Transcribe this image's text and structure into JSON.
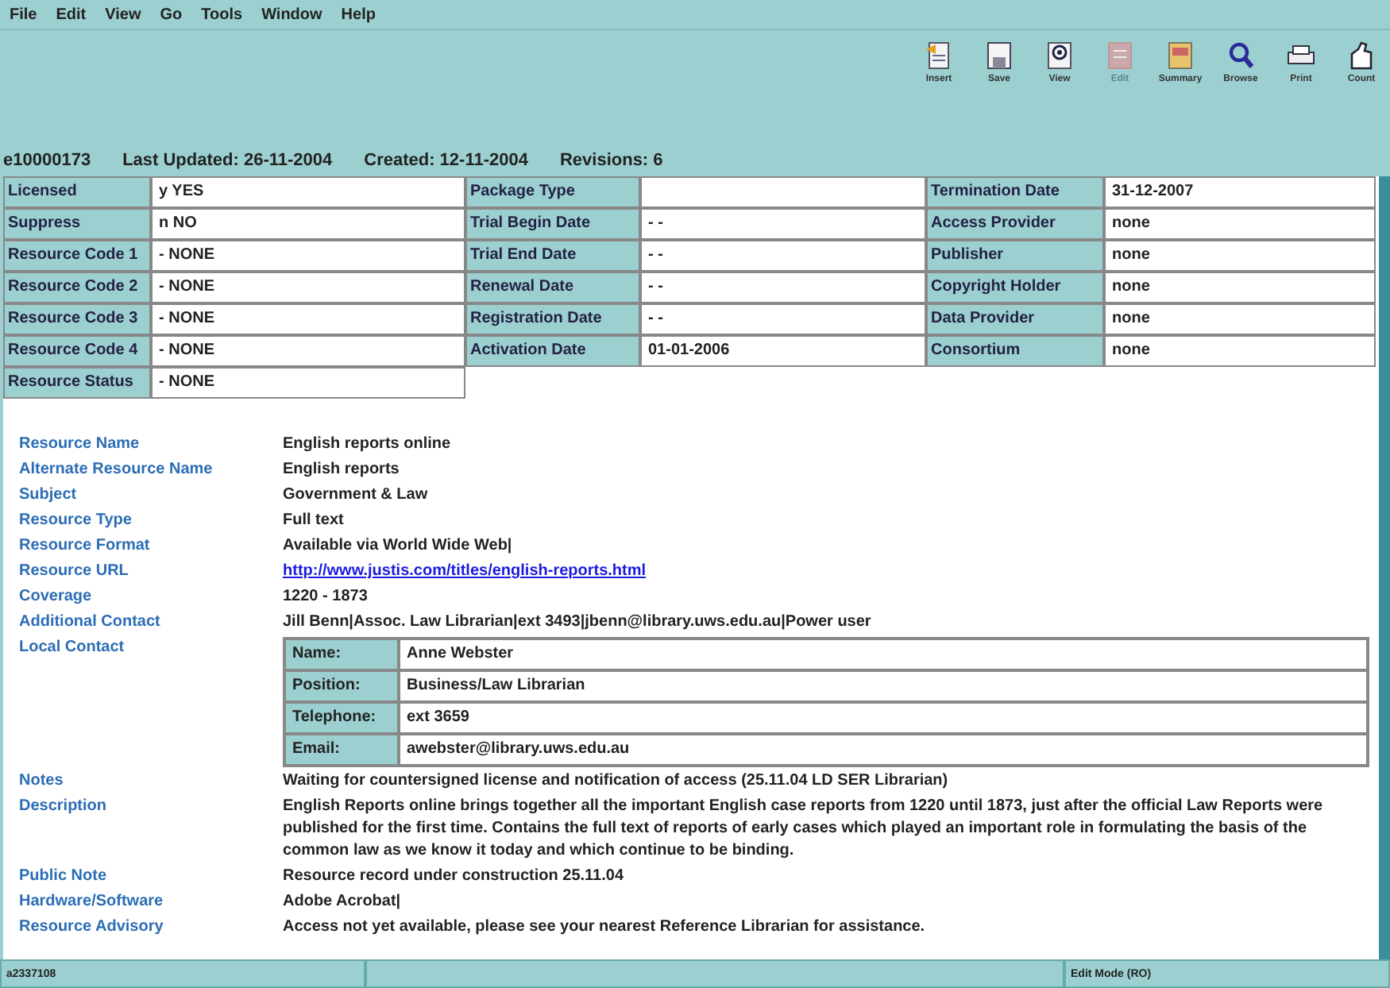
{
  "menu": [
    "File",
    "Edit",
    "View",
    "Go",
    "Tools",
    "Window",
    "Help"
  ],
  "toolbar": [
    {
      "label": "Insert",
      "kind": "insert",
      "disabled": false
    },
    {
      "label": "Save",
      "kind": "save",
      "disabled": false
    },
    {
      "label": "View",
      "kind": "view",
      "disabled": false
    },
    {
      "label": "Edit",
      "kind": "edit",
      "disabled": true
    },
    {
      "label": "Summary",
      "kind": "summary",
      "disabled": false
    },
    {
      "label": "Browse",
      "kind": "browse",
      "disabled": false
    },
    {
      "label": "Print",
      "kind": "print",
      "disabled": false
    },
    {
      "label": "Count",
      "kind": "count",
      "disabled": false
    }
  ],
  "record_header": {
    "id": "e10000173",
    "last_updated": "Last Updated: 26-11-2004",
    "created": "Created: 12-11-2004",
    "revisions": "Revisions: 6"
  },
  "fields": [
    [
      {
        "label": "Licensed",
        "value": "y  YES"
      },
      {
        "label": "Package Type"
      },
      {
        "label": "Termination Date",
        "value": "31-12-2007"
      }
    ],
    [
      {
        "label": "Suppress",
        "value": "n  NO"
      },
      {
        "label": "Trial Begin Date",
        "value": "- -"
      },
      {
        "label": "Access Provider",
        "value": "none"
      }
    ],
    [
      {
        "label": "Resource Code 1",
        "value": "-  NONE"
      },
      {
        "label": "Trial End Date",
        "value": "- -"
      },
      {
        "label": "Publisher",
        "value": "none"
      }
    ],
    [
      {
        "label": "Resource Code 2",
        "value": "-  NONE"
      },
      {
        "label": "Renewal Date",
        "value": "- -"
      },
      {
        "label": "Copyright Holder",
        "value": "none"
      }
    ],
    [
      {
        "label": "Resource Code 3",
        "value": "-  NONE"
      },
      {
        "label": "Registration Date",
        "value": "- -"
      },
      {
        "label": "Data Provider",
        "value": "none"
      }
    ],
    [
      {
        "label": "Resource Code 4",
        "value": "-  NONE"
      },
      {
        "label": "Activation Date",
        "value": "01-01-2006"
      },
      {
        "label": "Consortium",
        "value": "none"
      }
    ],
    [
      {
        "label": "Resource Status",
        "value": "-  NONE"
      }
    ]
  ],
  "details": [
    {
      "label": "Resource Name",
      "kind": "text",
      "value": "English reports online"
    },
    {
      "label": "Alternate Resource Name",
      "kind": "text",
      "value": "English reports"
    },
    {
      "label": "Subject",
      "kind": "text",
      "value": "Government & Law"
    },
    {
      "label": "Resource Type",
      "kind": "text",
      "value": "Full text"
    },
    {
      "label": "Resource Format",
      "kind": "text",
      "value": "Available via World Wide Web|"
    },
    {
      "label": "Resource URL",
      "kind": "link",
      "value": "http://www.justis.com/titles/english-reports.html"
    },
    {
      "label": "Coverage",
      "kind": "text",
      "value": "1220 - 1873"
    },
    {
      "label": "Additional Contact",
      "kind": "text",
      "value": "Jill Benn|Assoc. Law Librarian|ext 3493|jbenn@library.uws.edu.au|Power user"
    },
    {
      "label": "Local Contact",
      "kind": "contact",
      "rows": [
        {
          "label": "Name:",
          "value": "Anne Webster"
        },
        {
          "label": "Position:",
          "value": "Business/Law Librarian"
        },
        {
          "label": "Telephone:",
          "value": "ext 3659"
        },
        {
          "label": "Email:",
          "value": "awebster@library.uws.edu.au"
        }
      ]
    },
    {
      "label": "Notes",
      "kind": "text",
      "value": "Waiting for countersigned license and notification of access (25.11.04 LD SER Librarian)"
    },
    {
      "label": "Description",
      "kind": "text",
      "value": "English Reports online brings together all the important English case reports from 1220 until 1873, just after the official Law Reports were published for the first time.  Contains the full text of reports of early cases which played an important role in formulating the basis of the common law as we know it today and which continue to be binding."
    },
    {
      "label": "Public Note",
      "kind": "text",
      "value": "Resource record under construction 25.11.04"
    },
    {
      "label": "Hardware/Software",
      "kind": "text",
      "value": "Adobe Acrobat|"
    },
    {
      "label": "Resource Advisory",
      "kind": "text",
      "value": "Access not yet available, please see your nearest Reference Librarian for assistance."
    }
  ],
  "status_bar": {
    "left": "a2337108",
    "right": "Edit Mode (RO)"
  }
}
